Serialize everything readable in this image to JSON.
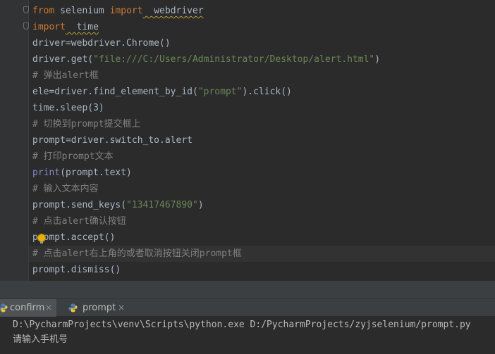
{
  "editor": {
    "lines": [
      {
        "kind": "import",
        "kw1": "from",
        "mid": " selenium ",
        "kw2": "import",
        "rest": "  webdriver"
      },
      {
        "kind": "import2",
        "kw1": "import",
        "rest": "  time"
      },
      {
        "kind": "plain",
        "text": "driver=webdriver.Chrome()"
      },
      {
        "kind": "call-str",
        "pre": "driver.get(",
        "str": "\"file:///C:/Users/Administrator/Desktop/alert.html\"",
        "post": ")"
      },
      {
        "kind": "comment",
        "text": "# 弹出alert框"
      },
      {
        "kind": "call-str",
        "pre": "ele=driver.find_element_by_id(",
        "str": "\"prompt\"",
        "post": ").click()"
      },
      {
        "kind": "plain",
        "text": "time.sleep(3)"
      },
      {
        "kind": "comment",
        "text": "# 切换到prompt提交框上"
      },
      {
        "kind": "plain",
        "text": "prompt=driver.switch_to.alert"
      },
      {
        "kind": "comment",
        "text": "# 打印prompt文本"
      },
      {
        "kind": "builtin",
        "bi": "print",
        "rest": "(prompt.text)"
      },
      {
        "kind": "comment",
        "text": "# 输入文本内容"
      },
      {
        "kind": "call-str",
        "pre": "prompt.send_keys(",
        "str": "\"13417467890\"",
        "post": ")"
      },
      {
        "kind": "comment",
        "text": "# 点击alert确认按钮"
      },
      {
        "kind": "plain",
        "text": "prompt.accept()"
      },
      {
        "kind": "comment",
        "text": "# 点击alert右上角的或者取消按钮关闭prompt框"
      },
      {
        "kind": "plain",
        "text": "prompt.dismiss()"
      }
    ]
  },
  "run_tabs": [
    {
      "label": "confirm",
      "close": "×"
    },
    {
      "label": "prompt",
      "close": "×"
    }
  ],
  "console": {
    "lines": [
      "D:\\PycharmProjects\\venv\\Scripts\\python.exe D:/PycharmProjects/zyjselenium/prompt.py",
      "请输入手机号"
    ]
  }
}
